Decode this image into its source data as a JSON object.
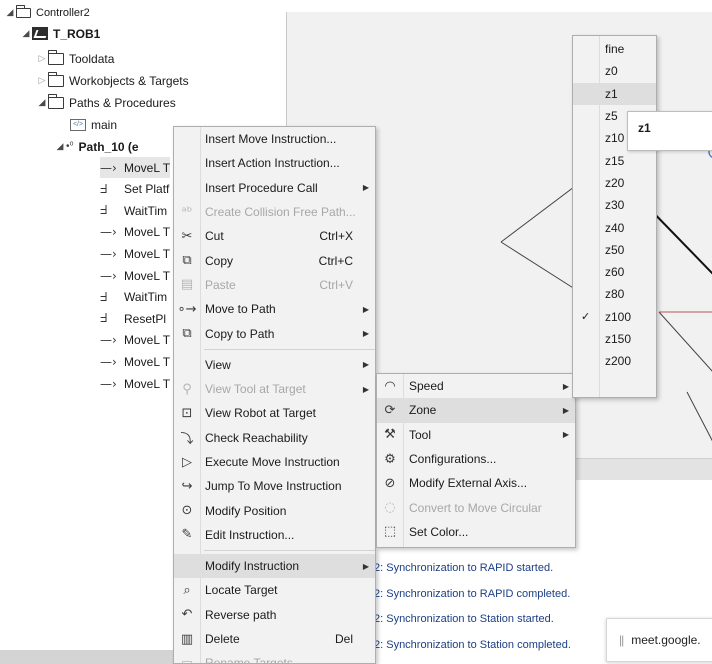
{
  "tree": {
    "controller": "Controller2",
    "task": "T_ROB1",
    "folders": [
      "Tooldata",
      "Workobjects & Targets",
      "Paths & Procedures"
    ],
    "module": "main",
    "path_name": "Path_10 (e",
    "instructions": [
      {
        "icon": "move-icon",
        "label": "MoveL T"
      },
      {
        "icon": "procedure-call-icon",
        "label": "Set Platf"
      },
      {
        "icon": "procedure-call-icon",
        "label": "WaitTim"
      },
      {
        "icon": "move-icon",
        "label": "MoveL T"
      },
      {
        "icon": "move-icon",
        "label": "MoveL T"
      },
      {
        "icon": "move-icon",
        "label": "MoveL T"
      },
      {
        "icon": "procedure-call-icon",
        "label": "WaitTim"
      },
      {
        "icon": "procedure-call-icon",
        "label": "ResetPl"
      },
      {
        "icon": "move-icon",
        "label": "MoveL T"
      },
      {
        "icon": "move-icon",
        "label": "MoveL T"
      },
      {
        "icon": "move-icon",
        "label": "MoveL T"
      }
    ]
  },
  "context_menu": {
    "items": [
      {
        "label": "Insert Move Instruction...",
        "icon": "",
        "shortcut": "",
        "submenu": false,
        "disabled": false
      },
      {
        "label": "Insert Action Instruction...",
        "icon": "",
        "shortcut": "",
        "submenu": false,
        "disabled": false
      },
      {
        "label": "Insert Procedure Call",
        "icon": "",
        "shortcut": "",
        "submenu": true,
        "disabled": false
      },
      {
        "label": "Create Collision Free Path...",
        "icon": "collision-path-icon",
        "shortcut": "",
        "submenu": false,
        "disabled": true
      },
      {
        "label": "Cut",
        "icon": "scissors-icon",
        "shortcut": "Ctrl+X",
        "submenu": false,
        "disabled": false
      },
      {
        "label": "Copy",
        "icon": "copy-icon",
        "shortcut": "Ctrl+C",
        "submenu": false,
        "disabled": false
      },
      {
        "label": "Paste",
        "icon": "paste-icon",
        "shortcut": "Ctrl+V",
        "submenu": false,
        "disabled": true
      },
      {
        "label": "Move to Path",
        "icon": "move-to-path-icon",
        "shortcut": "",
        "submenu": true,
        "disabled": false
      },
      {
        "label": "Copy to Path",
        "icon": "copy-to-path-icon",
        "shortcut": "",
        "submenu": true,
        "disabled": false
      },
      {
        "label": "View",
        "icon": "",
        "shortcut": "",
        "submenu": true,
        "disabled": false
      },
      {
        "label": "View Tool at Target",
        "icon": "tool-at-target-icon",
        "shortcut": "",
        "submenu": true,
        "disabled": true
      },
      {
        "label": "View Robot at Target",
        "icon": "robot-at-target-icon",
        "shortcut": "",
        "submenu": false,
        "disabled": false
      },
      {
        "label": "Check Reachability",
        "icon": "reachability-icon",
        "shortcut": "",
        "submenu": false,
        "disabled": false
      },
      {
        "label": "Execute Move Instruction",
        "icon": "play-icon",
        "shortcut": "",
        "submenu": false,
        "disabled": false
      },
      {
        "label": "Jump To Move Instruction",
        "icon": "jump-icon",
        "shortcut": "",
        "submenu": false,
        "disabled": false
      },
      {
        "label": "Modify Position",
        "icon": "modify-position-icon",
        "shortcut": "",
        "submenu": false,
        "disabled": false
      },
      {
        "label": "Edit Instruction...",
        "icon": "edit-icon",
        "shortcut": "",
        "submenu": false,
        "disabled": false
      },
      {
        "label": "Modify Instruction",
        "icon": "",
        "shortcut": "",
        "submenu": true,
        "disabled": false,
        "highlight": true
      },
      {
        "label": "Locate Target",
        "icon": "search-icon",
        "shortcut": "",
        "submenu": false,
        "disabled": false
      },
      {
        "label": "Reverse path",
        "icon": "undo-icon",
        "shortcut": "",
        "submenu": false,
        "disabled": false
      },
      {
        "label": "Delete",
        "icon": "trash-icon",
        "shortcut": "Del",
        "submenu": false,
        "disabled": false
      },
      {
        "label": "Rename Targets",
        "icon": "rename-icon",
        "shortcut": "",
        "submenu": false,
        "disabled": true
      }
    ]
  },
  "modify_submenu": {
    "items": [
      {
        "label": "Speed",
        "icon": "speed-icon",
        "submenu": true,
        "disabled": false
      },
      {
        "label": "Zone",
        "icon": "zone-icon",
        "submenu": true,
        "disabled": false,
        "highlight": true
      },
      {
        "label": "Tool",
        "icon": "tool-icon",
        "submenu": true,
        "disabled": false
      },
      {
        "label": "Configurations...",
        "icon": "configurations-icon",
        "submenu": false,
        "disabled": false
      },
      {
        "label": "Modify External Axis...",
        "icon": "external-axis-icon",
        "submenu": false,
        "disabled": false
      },
      {
        "label": "Convert to Move Circular",
        "icon": "circular-icon",
        "submenu": false,
        "disabled": true
      },
      {
        "label": "Set Color...",
        "icon": "color-icon",
        "submenu": false,
        "disabled": false
      }
    ]
  },
  "zone_menu": {
    "items": [
      "fine",
      "z0",
      "z1",
      "z5",
      "z10",
      "z15",
      "z20",
      "z30",
      "z40",
      "z50",
      "z60",
      "z80",
      "z100",
      "z150",
      "z200"
    ],
    "checked": "z100",
    "highlighted": "z1"
  },
  "tooltip": {
    "text": "z1"
  },
  "output": {
    "lines": [
      "2: Synchronization to RAPID started.",
      "2: Synchronization to RAPID completed.",
      "2: Synchronization to Station started.",
      "2: Synchronization to Station completed."
    ]
  },
  "toast": {
    "text": "meet.google."
  },
  "colors": {
    "menu_bg": "#f2f2f2",
    "highlight": "#dedede",
    "output_text": "#1c3f84",
    "disabled_text": "#a7a7a7"
  }
}
